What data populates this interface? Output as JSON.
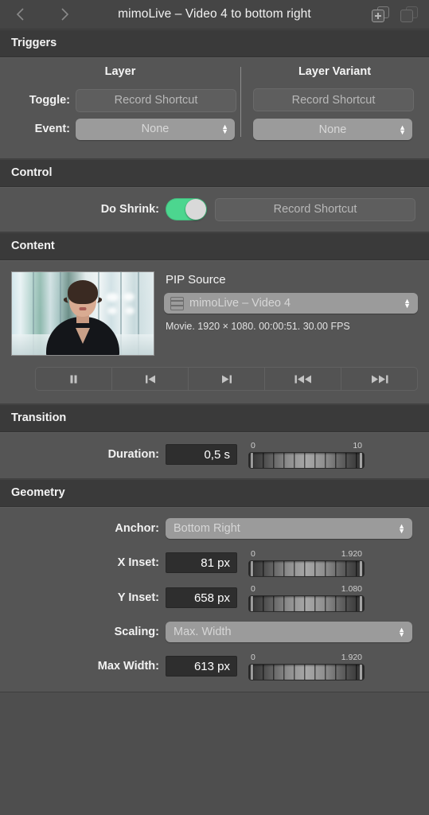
{
  "titlebar": {
    "title": "mimoLive – Video 4 to bottom right",
    "back_icon": "chevron-left-icon",
    "forward_icon": "chevron-right-icon",
    "add_variant_label": "add-variant-icon",
    "remove_variant_label": "remove-variant-icon"
  },
  "triggers": {
    "header": "Triggers",
    "columns": [
      {
        "title": "Layer",
        "toggle_button": "Record Shortcut",
        "event_value": "None"
      },
      {
        "title": "Layer Variant",
        "toggle_button": "Record Shortcut",
        "event_value": "None"
      }
    ],
    "labels": {
      "toggle": "Toggle:",
      "event": "Event:"
    }
  },
  "control": {
    "header": "Control",
    "do_shrink_label": "Do Shrink:",
    "do_shrink_state": "on",
    "record_shortcut": "Record Shortcut",
    "toggle_color": "#4cd68f"
  },
  "content": {
    "header": "Content",
    "pip_source_title": "PIP Source",
    "pip_source_value": "mimoLive – Video 4",
    "pip_source_icon": "film-strip-icon",
    "media_info": "Movie. 1920 × 1080. 00:00:51. 30.00 FPS",
    "transport": [
      {
        "name": "pause-button",
        "icon": "pause-icon"
      },
      {
        "name": "step-backward-button",
        "icon": "step-backward-icon"
      },
      {
        "name": "step-forward-button",
        "icon": "step-forward-icon"
      },
      {
        "name": "rewind-button",
        "icon": "rewind-icon"
      },
      {
        "name": "fast-forward-button",
        "icon": "fast-forward-icon"
      }
    ]
  },
  "transition": {
    "header": "Transition",
    "duration_label": "Duration:",
    "duration_value": "0,5 s",
    "duration_min": "0",
    "duration_max": "10"
  },
  "geometry": {
    "header": "Geometry",
    "anchor_label": "Anchor:",
    "anchor_value": "Bottom Right",
    "x_inset_label": "X Inset:",
    "x_inset_value": "81 px",
    "x_inset_min": "0",
    "x_inset_max": "1.920",
    "y_inset_label": "Y Inset:",
    "y_inset_value": "658 px",
    "y_inset_min": "0",
    "y_inset_max": "1.080",
    "scaling_label": "Scaling:",
    "scaling_value": "Max. Width",
    "max_width_label": "Max Width:",
    "max_width_value": "613 px",
    "max_width_min": "0",
    "max_width_max": "1.920"
  }
}
